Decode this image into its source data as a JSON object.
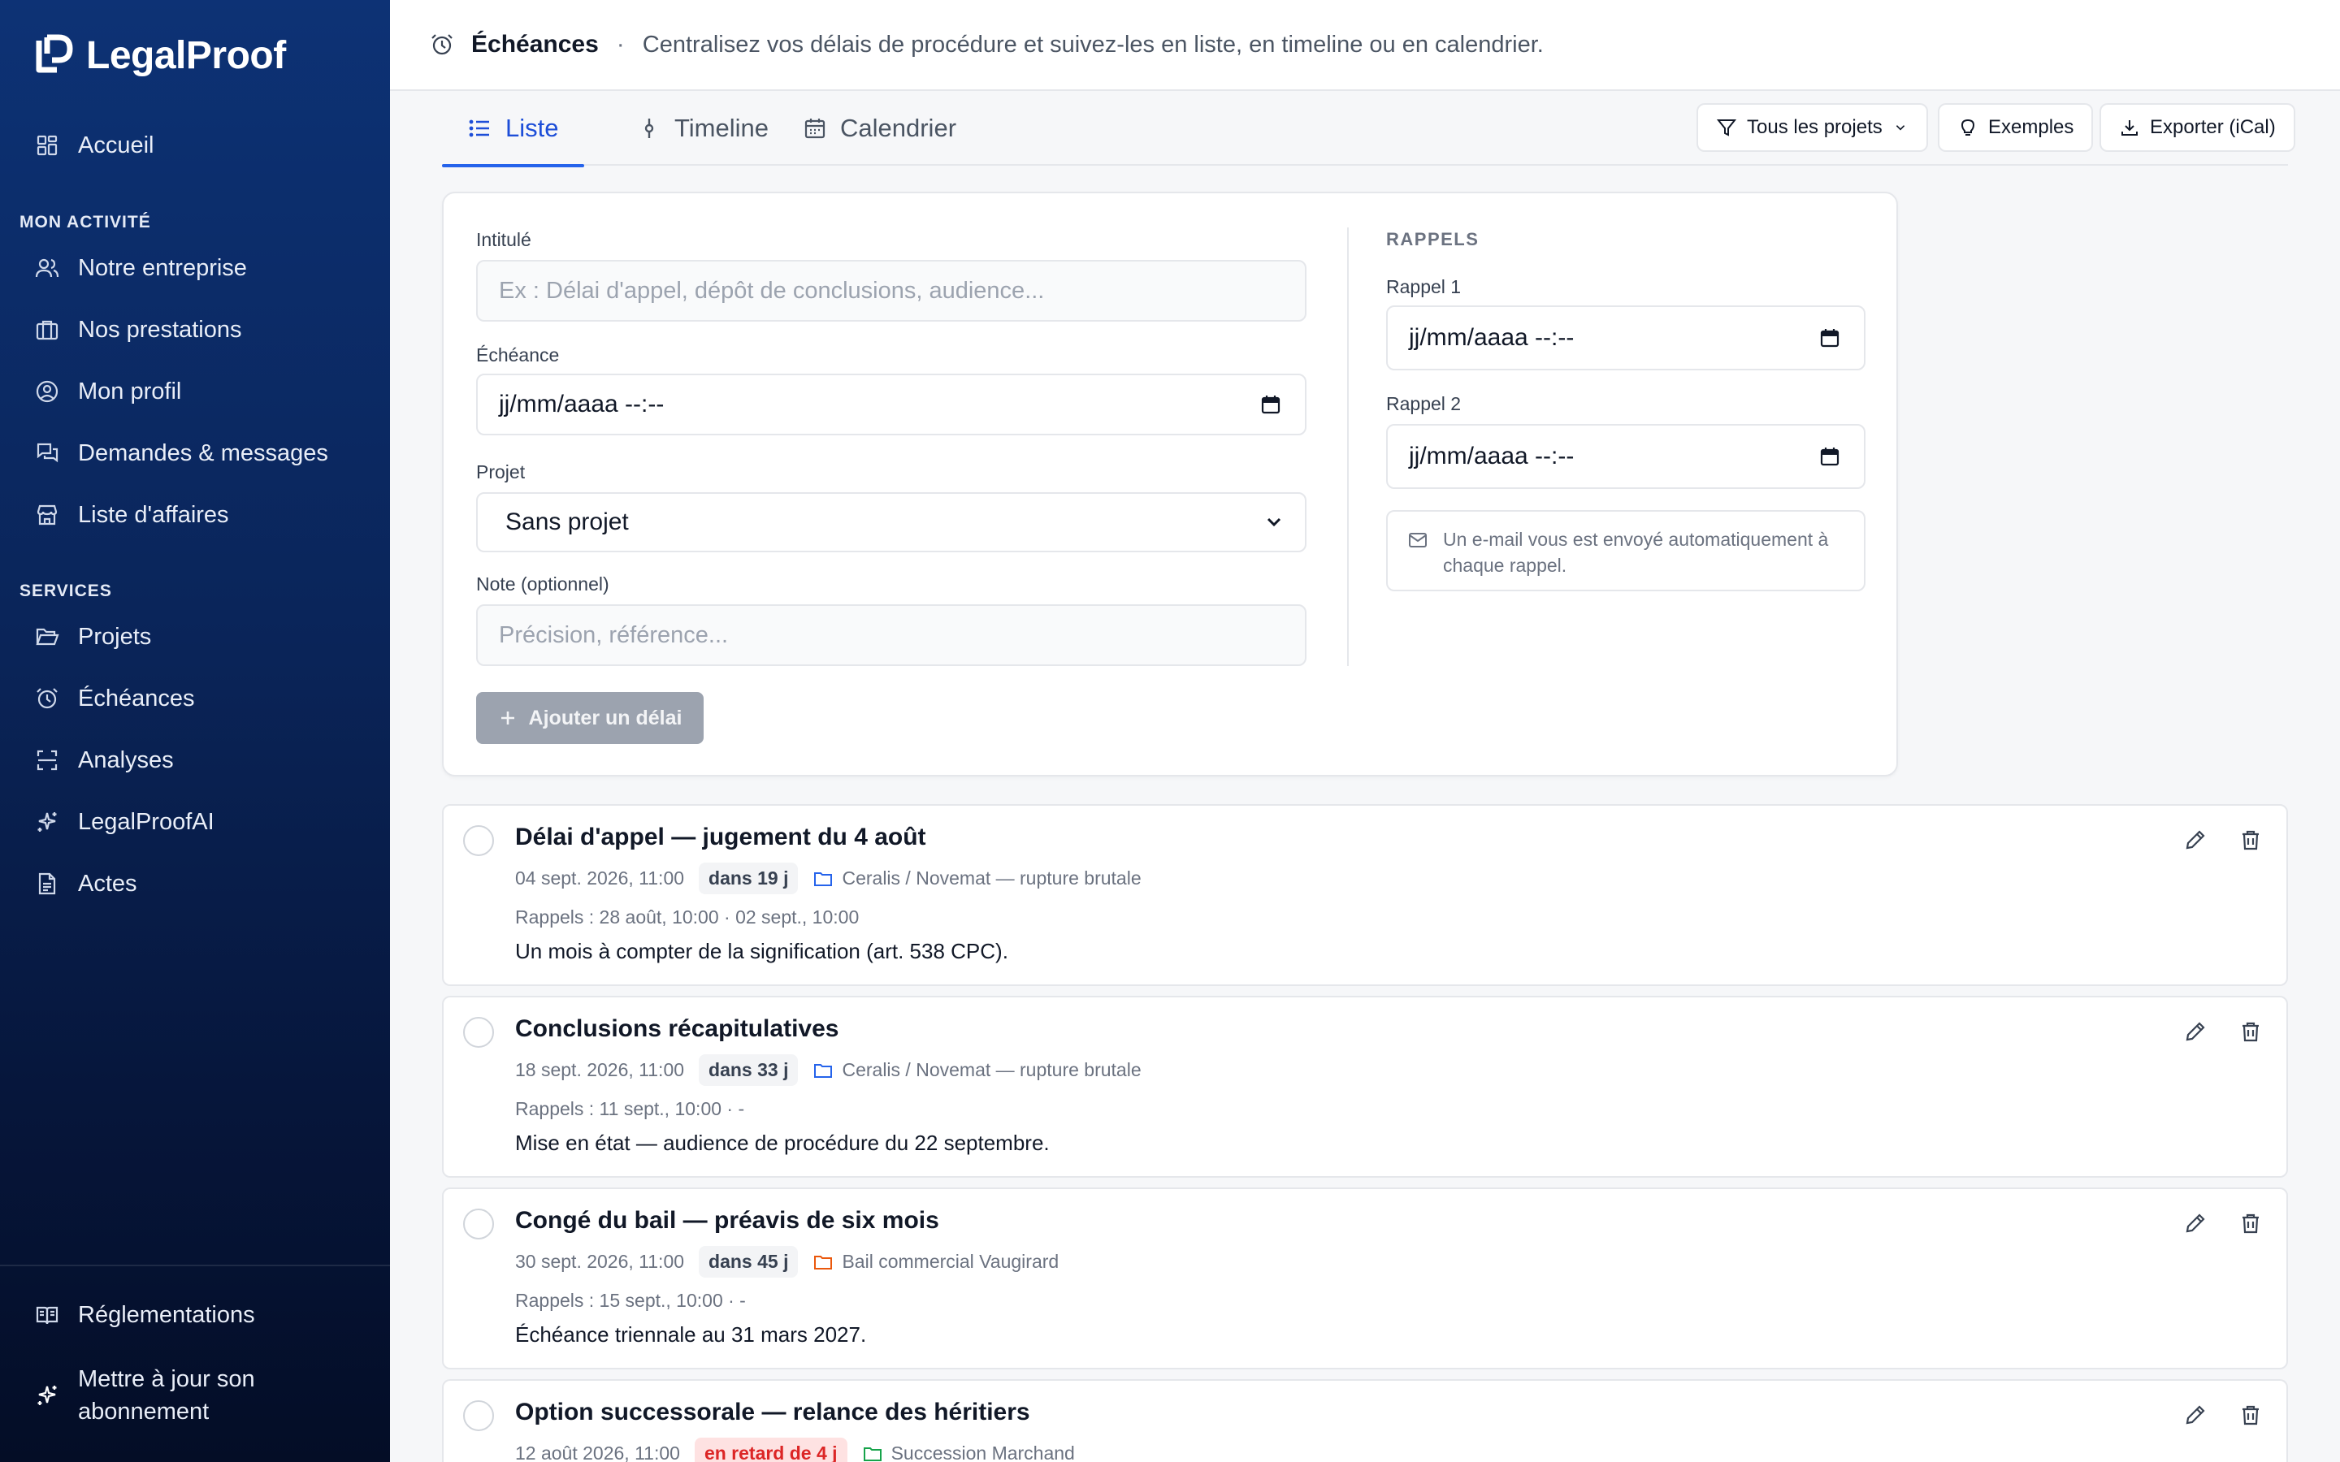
{
  "brand": {
    "name": "LegalProof"
  },
  "sidebar": {
    "home": "Accueil",
    "section1": "MON ACTIVITÉ",
    "activity": [
      "Notre entreprise",
      "Nos prestations",
      "Mon profil",
      "Demandes & messages",
      "Liste d'affaires"
    ],
    "section2": "SERVICES",
    "services": [
      "Projets",
      "Échéances",
      "Analyses",
      "LegalProofAI",
      "Actes"
    ],
    "footer": [
      "Réglementations",
      "Mettre à jour son abonnement"
    ]
  },
  "header": {
    "title": "Échéances",
    "separator": "·",
    "subtitle": "Centralisez vos délais de procédure et suivez-les en liste, en timeline ou en calendrier."
  },
  "tabs": [
    "Liste",
    "Timeline",
    "Calendrier"
  ],
  "toolbar": {
    "filter": "Tous les projets",
    "examples": "Exemples",
    "export": "Exporter (iCal)"
  },
  "form": {
    "title_label": "Intitulé",
    "title_placeholder": "Ex : Délai d'appel, dépôt de conclusions, audience...",
    "due_label": "Échéance",
    "date_placeholder": "jj/mm/aaaa  --:--",
    "project_label": "Projet",
    "project_value": "Sans projet",
    "note_label": "Note (optionnel)",
    "note_placeholder": "Précision, référence...",
    "reminders_title": "RAPPELS",
    "reminder1_label": "Rappel 1",
    "reminder2_label": "Rappel 2",
    "info": "Un e-mail vous est envoyé automatiquement à chaque rappel.",
    "submit": "Ajouter un délai"
  },
  "deadlines": [
    {
      "title": "Délai d'appel — jugement du 4 août",
      "date": "04 sept. 2026, 11:00",
      "badge": "dans 19 j",
      "project": "Ceralis / Novemat — rupture brutale",
      "rappels": "Rappels : 28 août, 10:00 · 02 sept., 10:00",
      "note": "Un mois à compter de la signification (art. 538 CPC)."
    },
    {
      "title": "Conclusions récapitulatives",
      "date": "18 sept. 2026, 11:00",
      "badge": "dans 33 j",
      "project": "Ceralis / Novemat — rupture brutale",
      "rappels": "Rappels : 11 sept., 10:00 · -",
      "note": "Mise en état — audience de procédure du 22 septembre."
    },
    {
      "title": "Congé du bail — préavis de six mois",
      "date": "30 sept. 2026, 11:00",
      "badge": "dans 45 j",
      "project": "Bail commercial Vaugirard",
      "rappels": "Rappels : 15 sept., 10:00 · -",
      "note": "Échéance triennale au 31 mars 2027."
    },
    {
      "title": "Option successorale — relance des héritiers",
      "date": "12 août 2026, 11:00",
      "badge": "en retard de 4 j",
      "project": "Succession Marchand",
      "rappels": "",
      "note": ""
    }
  ],
  "colors": {
    "accent": "#2563eb",
    "late": "#dc2626",
    "folder_blue": "#2563eb",
    "folder_orange": "#ea580c",
    "folder_green": "#16a34a"
  }
}
